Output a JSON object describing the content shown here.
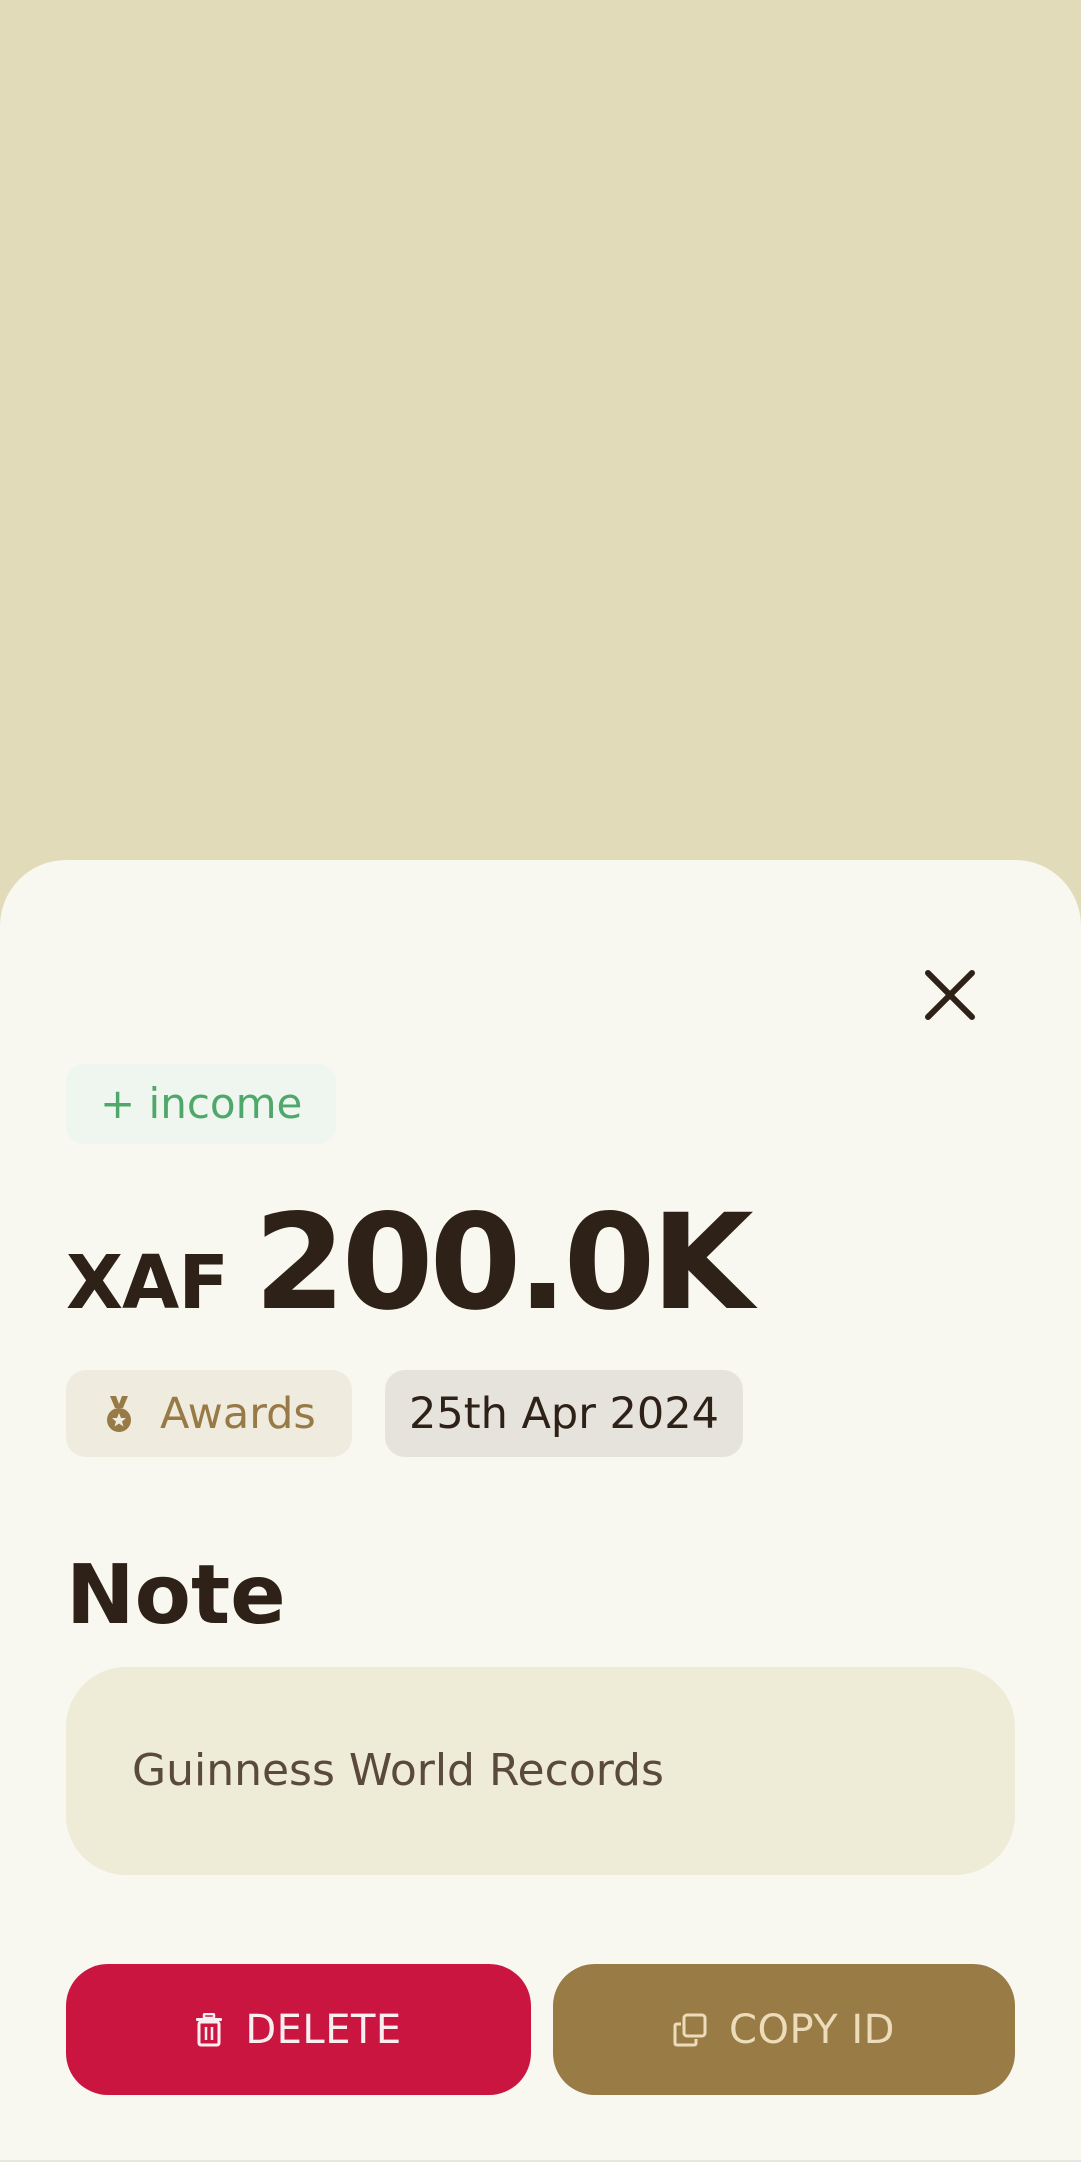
{
  "transaction": {
    "type_label": "+ income",
    "currency": "XAF",
    "amount": "200.0K",
    "category": {
      "label": "Awards",
      "icon": "medal-icon"
    },
    "date": "25th Apr 2024"
  },
  "note": {
    "title": "Note",
    "text": "Guinness World Records"
  },
  "actions": {
    "delete_label": "DELETE",
    "copy_label": "COPY ID"
  },
  "colors": {
    "backdrop": "#e1dbba",
    "sheet": "#f8f7f0",
    "income_green": "#4fa86a",
    "delete_red": "#cb1541",
    "copy_brown": "#987b45",
    "text_dark": "#2e2118"
  }
}
